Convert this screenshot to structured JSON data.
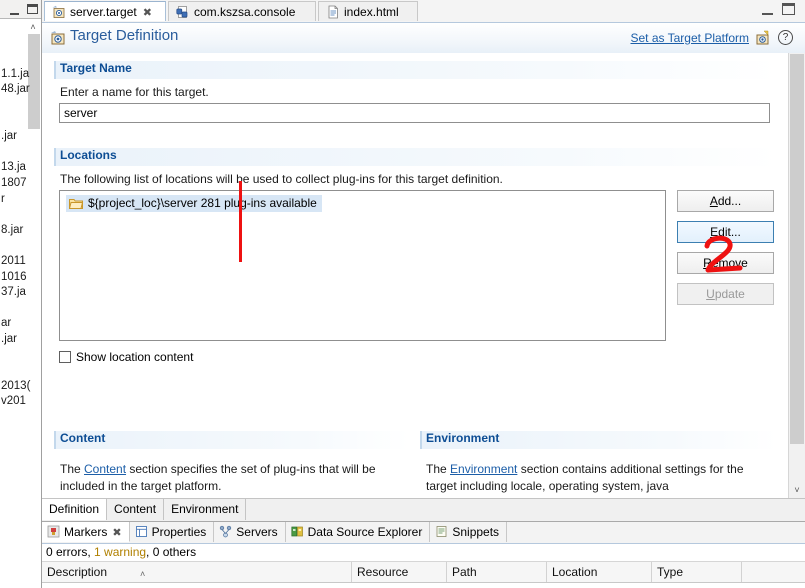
{
  "window": {
    "minimize_label": "minimize",
    "maximize_label": "maximize"
  },
  "editor_tabs": [
    {
      "label": "server.target",
      "icon": "target-definition-icon",
      "active": true,
      "closeable": true,
      "close_glyph": "✖"
    },
    {
      "label": "com.kszsa.console",
      "icon": "manifest-icon",
      "active": false,
      "closeable": false
    },
    {
      "label": "index.html",
      "icon": "html-file-icon",
      "active": false,
      "closeable": false
    }
  ],
  "form": {
    "title": "Target Definition",
    "title_icon": "target-definition-icon",
    "set_as_target_platform": "Set as Target Platform",
    "set_target_icon": "target-platform-icon",
    "help_icon": "?"
  },
  "target_name_section": {
    "title": "Target Name",
    "description": "Enter a name for this target.",
    "input_value": "server",
    "input_placeholder": ""
  },
  "locations_section": {
    "title": "Locations",
    "description": "The following list of locations will be used to collect plug-ins for this target definition.",
    "entries": [
      {
        "icon": "folder-icon",
        "text": "${project_loc}\\server 281 plug-ins available",
        "selected": true
      }
    ],
    "buttons": [
      {
        "label": "Add...",
        "mnemonic": "A",
        "state": "normal",
        "name": "add-location-button"
      },
      {
        "label": "Edit...",
        "mnemonic": "E",
        "state": "focused",
        "name": "edit-location-button"
      },
      {
        "label": "Remove",
        "mnemonic": "R",
        "state": "normal",
        "name": "remove-location-button"
      },
      {
        "label": "Update",
        "mnemonic": "U",
        "state": "disabled",
        "name": "update-location-button"
      }
    ],
    "show_location_content": {
      "label": "Show location content",
      "checked": false
    }
  },
  "content_section": {
    "title": "Content",
    "text_before": "The ",
    "link": "Content",
    "text_after": " section specifies the set of plug-ins that will be included in the target platform."
  },
  "environment_section": {
    "title": "Environment",
    "text_before": "The ",
    "link": "Environment",
    "text_after": " section contains additional settings for the target including locale, operating system, java"
  },
  "page_tabs": [
    {
      "label": "Definition",
      "active": true
    },
    {
      "label": "Content",
      "active": false
    },
    {
      "label": "Environment",
      "active": false
    }
  ],
  "bottom_views": {
    "tabs": [
      {
        "label": "Markers",
        "icon": "markers-icon",
        "active": true,
        "closeable": true,
        "close_glyph": "✖"
      },
      {
        "label": "Properties",
        "icon": "properties-icon",
        "active": false,
        "closeable": false
      },
      {
        "label": "Servers",
        "icon": "servers-icon",
        "active": false,
        "closeable": false
      },
      {
        "label": "Data Source Explorer",
        "icon": "data-source-icon",
        "active": false,
        "closeable": false
      },
      {
        "label": "Snippets",
        "icon": "snippets-icon",
        "active": false,
        "closeable": false
      }
    ],
    "summary_errors": "0 errors, ",
    "summary_warning": "1 warning",
    "summary_others": ", 0 others",
    "columns": [
      {
        "label": "Description",
        "sorted": true,
        "sort_glyph": "˄"
      },
      {
        "label": "Resource",
        "sorted": false
      },
      {
        "label": "Path",
        "sorted": false
      },
      {
        "label": "Location",
        "sorted": false
      },
      {
        "label": "Type",
        "sorted": false
      }
    ]
  },
  "left_tree_fragments": [
    "",
    "",
    "",
    "1.1.ja",
    "48.jar",
    "",
    "",
    ".jar",
    "",
    "13.ja",
    "1807",
    "r",
    "",
    "8.jar",
    "",
    "2011",
    "1016",
    "37.ja",
    "",
    "ar",
    ".jar",
    "",
    "",
    "2013(",
    "v201"
  ],
  "annotations": {
    "vertical_line_color": "#ee1111",
    "digit": "2",
    "digit_color": "#ee1111"
  }
}
